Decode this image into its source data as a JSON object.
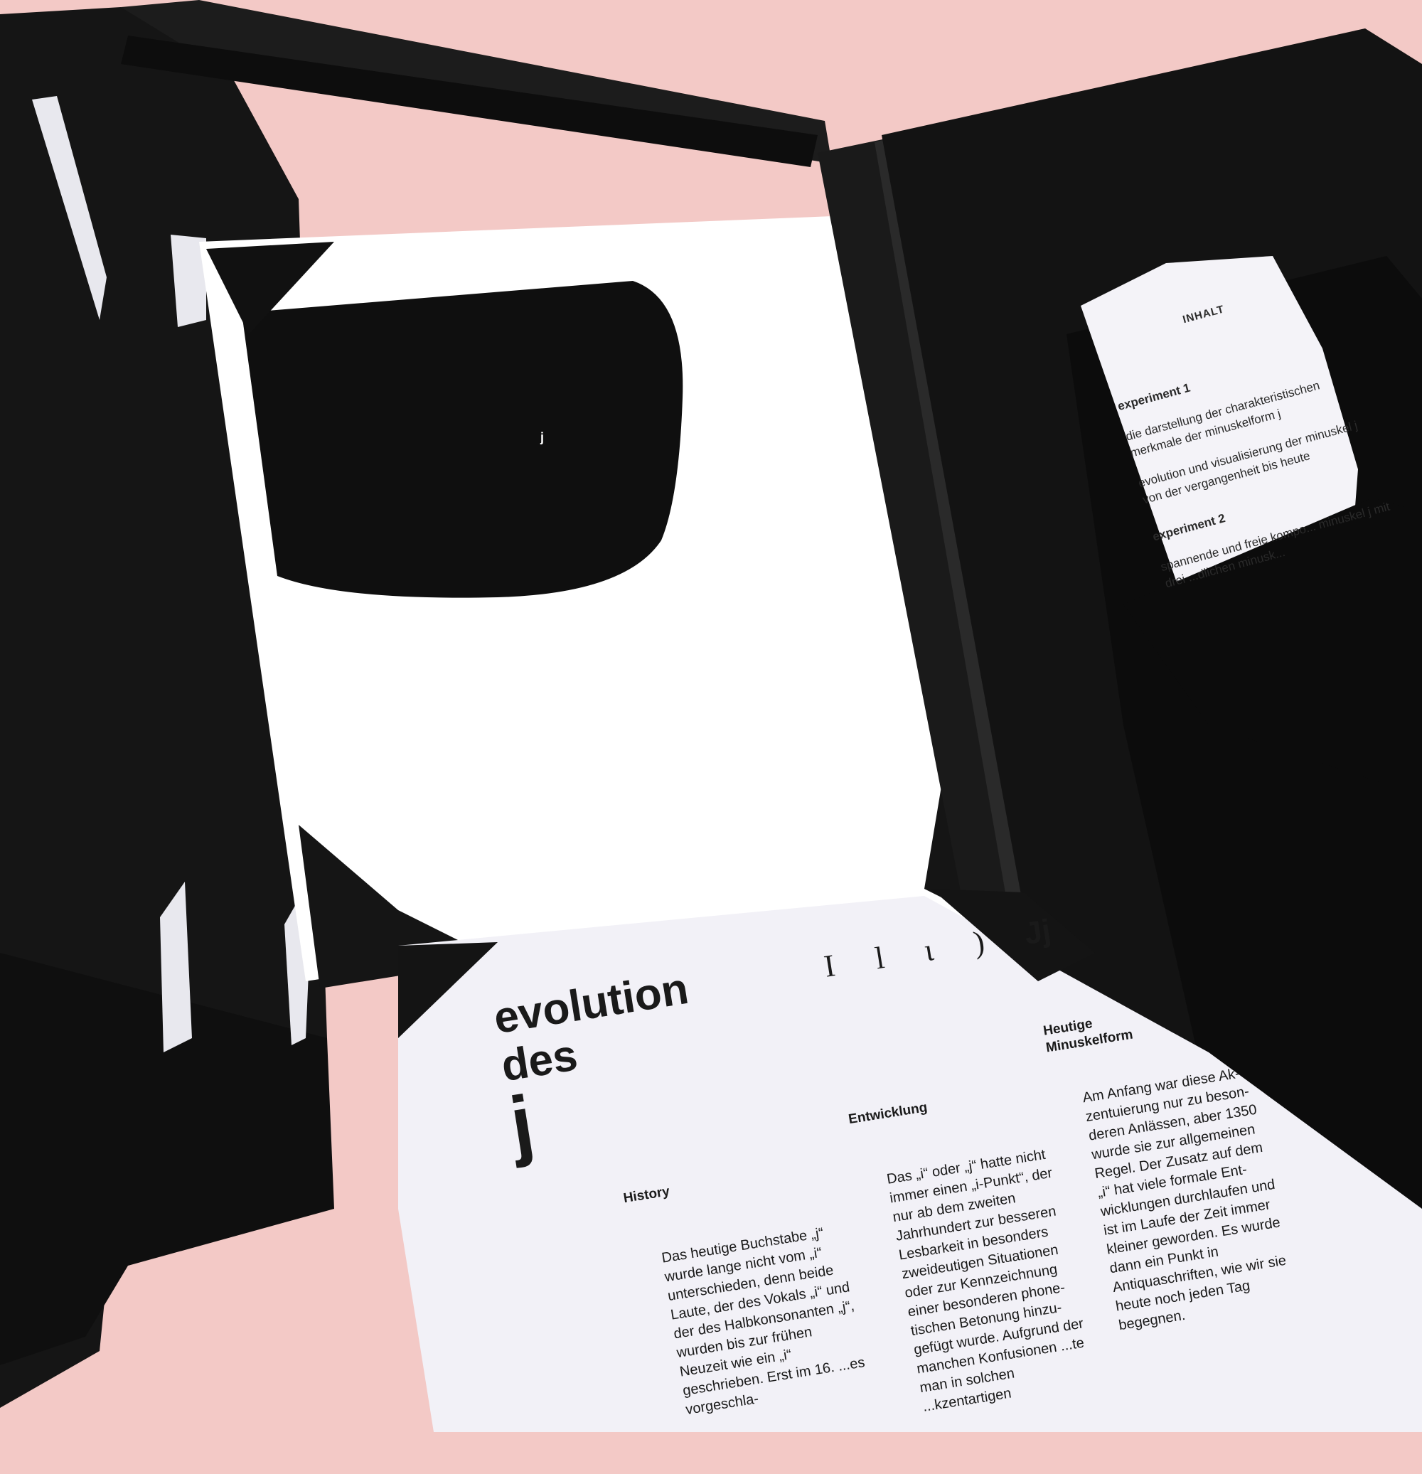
{
  "inhalt": {
    "title": "INHALT",
    "experiment1_label": "experiment 1",
    "experiment1_item1": "die darstellung der charakteristischen merkmale der minuskelform j",
    "experiment1_item2": "evolution und visualisierung der minuskel j von der vergangenheit bis heute",
    "experiment2_label": "experiment 2",
    "experiment2_item1": "spannende und freie kompo... minuskel j mit drei ...dlichen minusk..."
  },
  "big_page": {
    "small_glyph": "j"
  },
  "sheet": {
    "headline_line1": "evolution",
    "headline_line2": "des",
    "headline_line3": "j",
    "glyphs": [
      "I",
      "l",
      "ι",
      ")",
      "Jj"
    ],
    "history_head": "History",
    "history_text": "Das heutige Buchstabe „j“ wurde lange nicht vom „i“ unterschieden, denn beide Laute, der des Vokals „i“ und der des Halbkonso­nanten „j“, wurden bis zur frühen Neuzeit wie ein „i“ geschrieben. Erst im 16. ...es vorgeschla-",
    "entwicklung_head": "Entwicklung",
    "entwicklung_text": "Das „i“ oder „j“ hatte nicht immer einen „i-Punkt“, der nur ab dem zweiten Jahrhundert zur besseren Lesbarkeit in besonders zweideutigen Situationen oder zur Kennzeichnung einer besonderen phone­tischen Betonung hinzu­gefügt wurde. Aufgrund der manchen Konfusionen ...te man in solchen ...kzentartigen",
    "heutige_head": "Heutige Minuskelform",
    "heutige_text": "Am Anfang war diese Ak­zentuierung nur zu beson­deren Anlässen, aber 1350 wurde sie zur allgemeinen Regel. Der Zusatz auf dem „i“ hat viele formale Ent­wicklungen durchlaufen und ist im Laufe der Zeit immer kleiner geworden. Es wurde dann ein Punkt in Antiquaschriften, wie wir sie heute noch jeden Tag begegnen."
  },
  "colors": {
    "background": "#f3c9c6",
    "folder": "#111111",
    "paper": "#f4f3f8"
  }
}
